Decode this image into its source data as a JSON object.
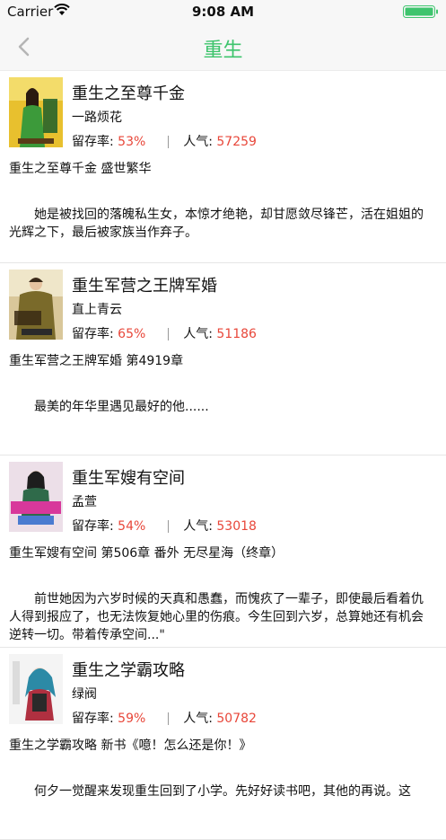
{
  "status_bar": {
    "carrier": "Carrier",
    "time": "9:08 AM"
  },
  "nav": {
    "title": "重生",
    "back_icon": "chevron-left-icon"
  },
  "colors": {
    "accent": "#3ec46d",
    "stat_value": "#e8473a"
  },
  "stats_labels": {
    "retention": "留存率:",
    "popularity": "人气:"
  },
  "books": [
    {
      "title": "重生之至尊千金",
      "author": "一路烦花",
      "retention": "53%",
      "popularity": "57259",
      "latest_chapter": "重生之至尊千金 盛世繁华",
      "description": "她是被找回的落魄私生女，本惊才绝艳，却甘愿敛尽锋芒，活在姐姐的光辉之下，最后被家族当作弃子。"
    },
    {
      "title": "重生军营之王牌军婚",
      "author": "直上青云",
      "retention": "65%",
      "popularity": "51186",
      "latest_chapter": "重生军营之王牌军婚 第4919章",
      "description": "最美的年华里遇见最好的他......"
    },
    {
      "title": "重生军嫂有空间",
      "author": "孟萱",
      "retention": "54%",
      "popularity": "53018",
      "latest_chapter": "重生军嫂有空间 第506章 番外 无尽星海（终章）",
      "description": "前世她因为六岁时候的天真和愚蠢，而愧疚了一辈子，即使最后看着仇人得到报应了，也无法恢复她心里的伤痕。今生回到六岁，总算她还有机会逆转一切。带着传承空间...\""
    },
    {
      "title": "重生之学霸攻略",
      "author": "绿阀",
      "retention": "59%",
      "popularity": "50782",
      "latest_chapter": "重生之学霸攻略 新书《噫！怎么还是你！》",
      "description": "何夕一觉醒来发现重生回到了小学。先好好读书吧，其他的再说。这"
    }
  ]
}
